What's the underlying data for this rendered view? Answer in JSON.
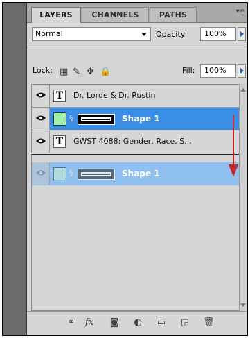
{
  "tabs": [
    {
      "label": "LAYERS",
      "active": true
    },
    {
      "label": "CHANNELS",
      "active": false
    },
    {
      "label": "PATHS",
      "active": false
    }
  ],
  "blend_mode": "Normal",
  "opacity": {
    "label": "Opacity:",
    "value": "100%"
  },
  "lock": {
    "label": "Lock:"
  },
  "fill": {
    "label": "Fill:",
    "value": "100%"
  },
  "layers": [
    {
      "type": "text",
      "name": "Dr. Lorde & Dr. Rustin",
      "selected": false
    },
    {
      "type": "shape",
      "name": "Shape 1",
      "selected": true,
      "swatch_color": "#9ff0a8"
    },
    {
      "type": "text",
      "name": "GWST 4088:  Gender, Race, S...",
      "selected": false
    }
  ],
  "drag_ghost": {
    "name": "Shape 1"
  },
  "colors": {
    "selection": "#3a8ee6",
    "ghost": "#8fc0ef",
    "annotation_arrow": "#c62828"
  },
  "bottom_icons": [
    "link-icon",
    "fx-icon",
    "mask-icon",
    "adjustment-icon",
    "folder-icon",
    "new-layer-icon",
    "trash-icon"
  ]
}
